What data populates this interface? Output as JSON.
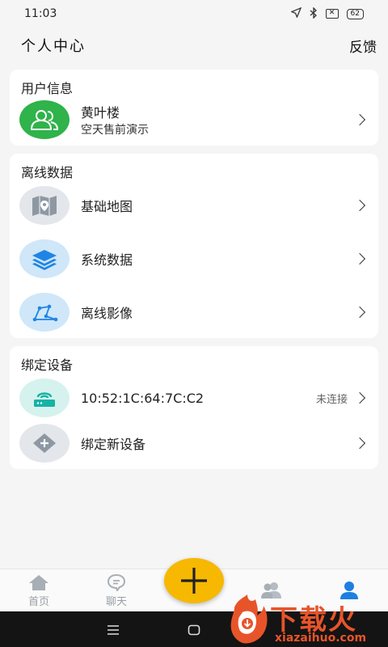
{
  "status_bar": {
    "time": "11:03",
    "battery": "62",
    "location_icon": "navigation-arrow-icon",
    "bluetooth_icon": "bluetooth-icon",
    "sim_icon": "no-sim-icon"
  },
  "header": {
    "title": "个人中心",
    "feedback_label": "反馈"
  },
  "user_card": {
    "title": "用户信息",
    "name": "黄叶楼",
    "org": "空天售前演示",
    "avatar_icon": "users-icon",
    "avatar_color": "#2fb34a"
  },
  "offline_card": {
    "title": "离线数据",
    "items": [
      {
        "label": "基础地图",
        "icon": "map-icon",
        "color": "#e3e6ea"
      },
      {
        "label": "系统数据",
        "icon": "layers-icon",
        "color": "#cfe7f8"
      },
      {
        "label": "离线影像",
        "icon": "polyline-icon",
        "color": "#cfe7f8"
      }
    ]
  },
  "device_card": {
    "title": "绑定设备",
    "device": {
      "label": "10:52:1C:64:7C:C2",
      "status": "未连接",
      "icon": "router-icon",
      "color": "#d6f2ee"
    },
    "add": {
      "label": "绑定新设备",
      "icon": "add-device-icon",
      "color": "#e3e6ea"
    }
  },
  "bottom_nav": {
    "items": [
      {
        "label": "首页",
        "icon": "home-icon"
      },
      {
        "label": "聊天",
        "icon": "chat-icon"
      },
      {
        "label": "",
        "icon": "contacts-icon"
      },
      {
        "label": "",
        "icon": "profile-icon"
      }
    ],
    "fab_icon": "plus-icon",
    "accent": "#f6b800",
    "active_color": "#1e7fe0"
  },
  "watermark": {
    "text": "下载火",
    "domain": "xiazaihuo.com"
  }
}
